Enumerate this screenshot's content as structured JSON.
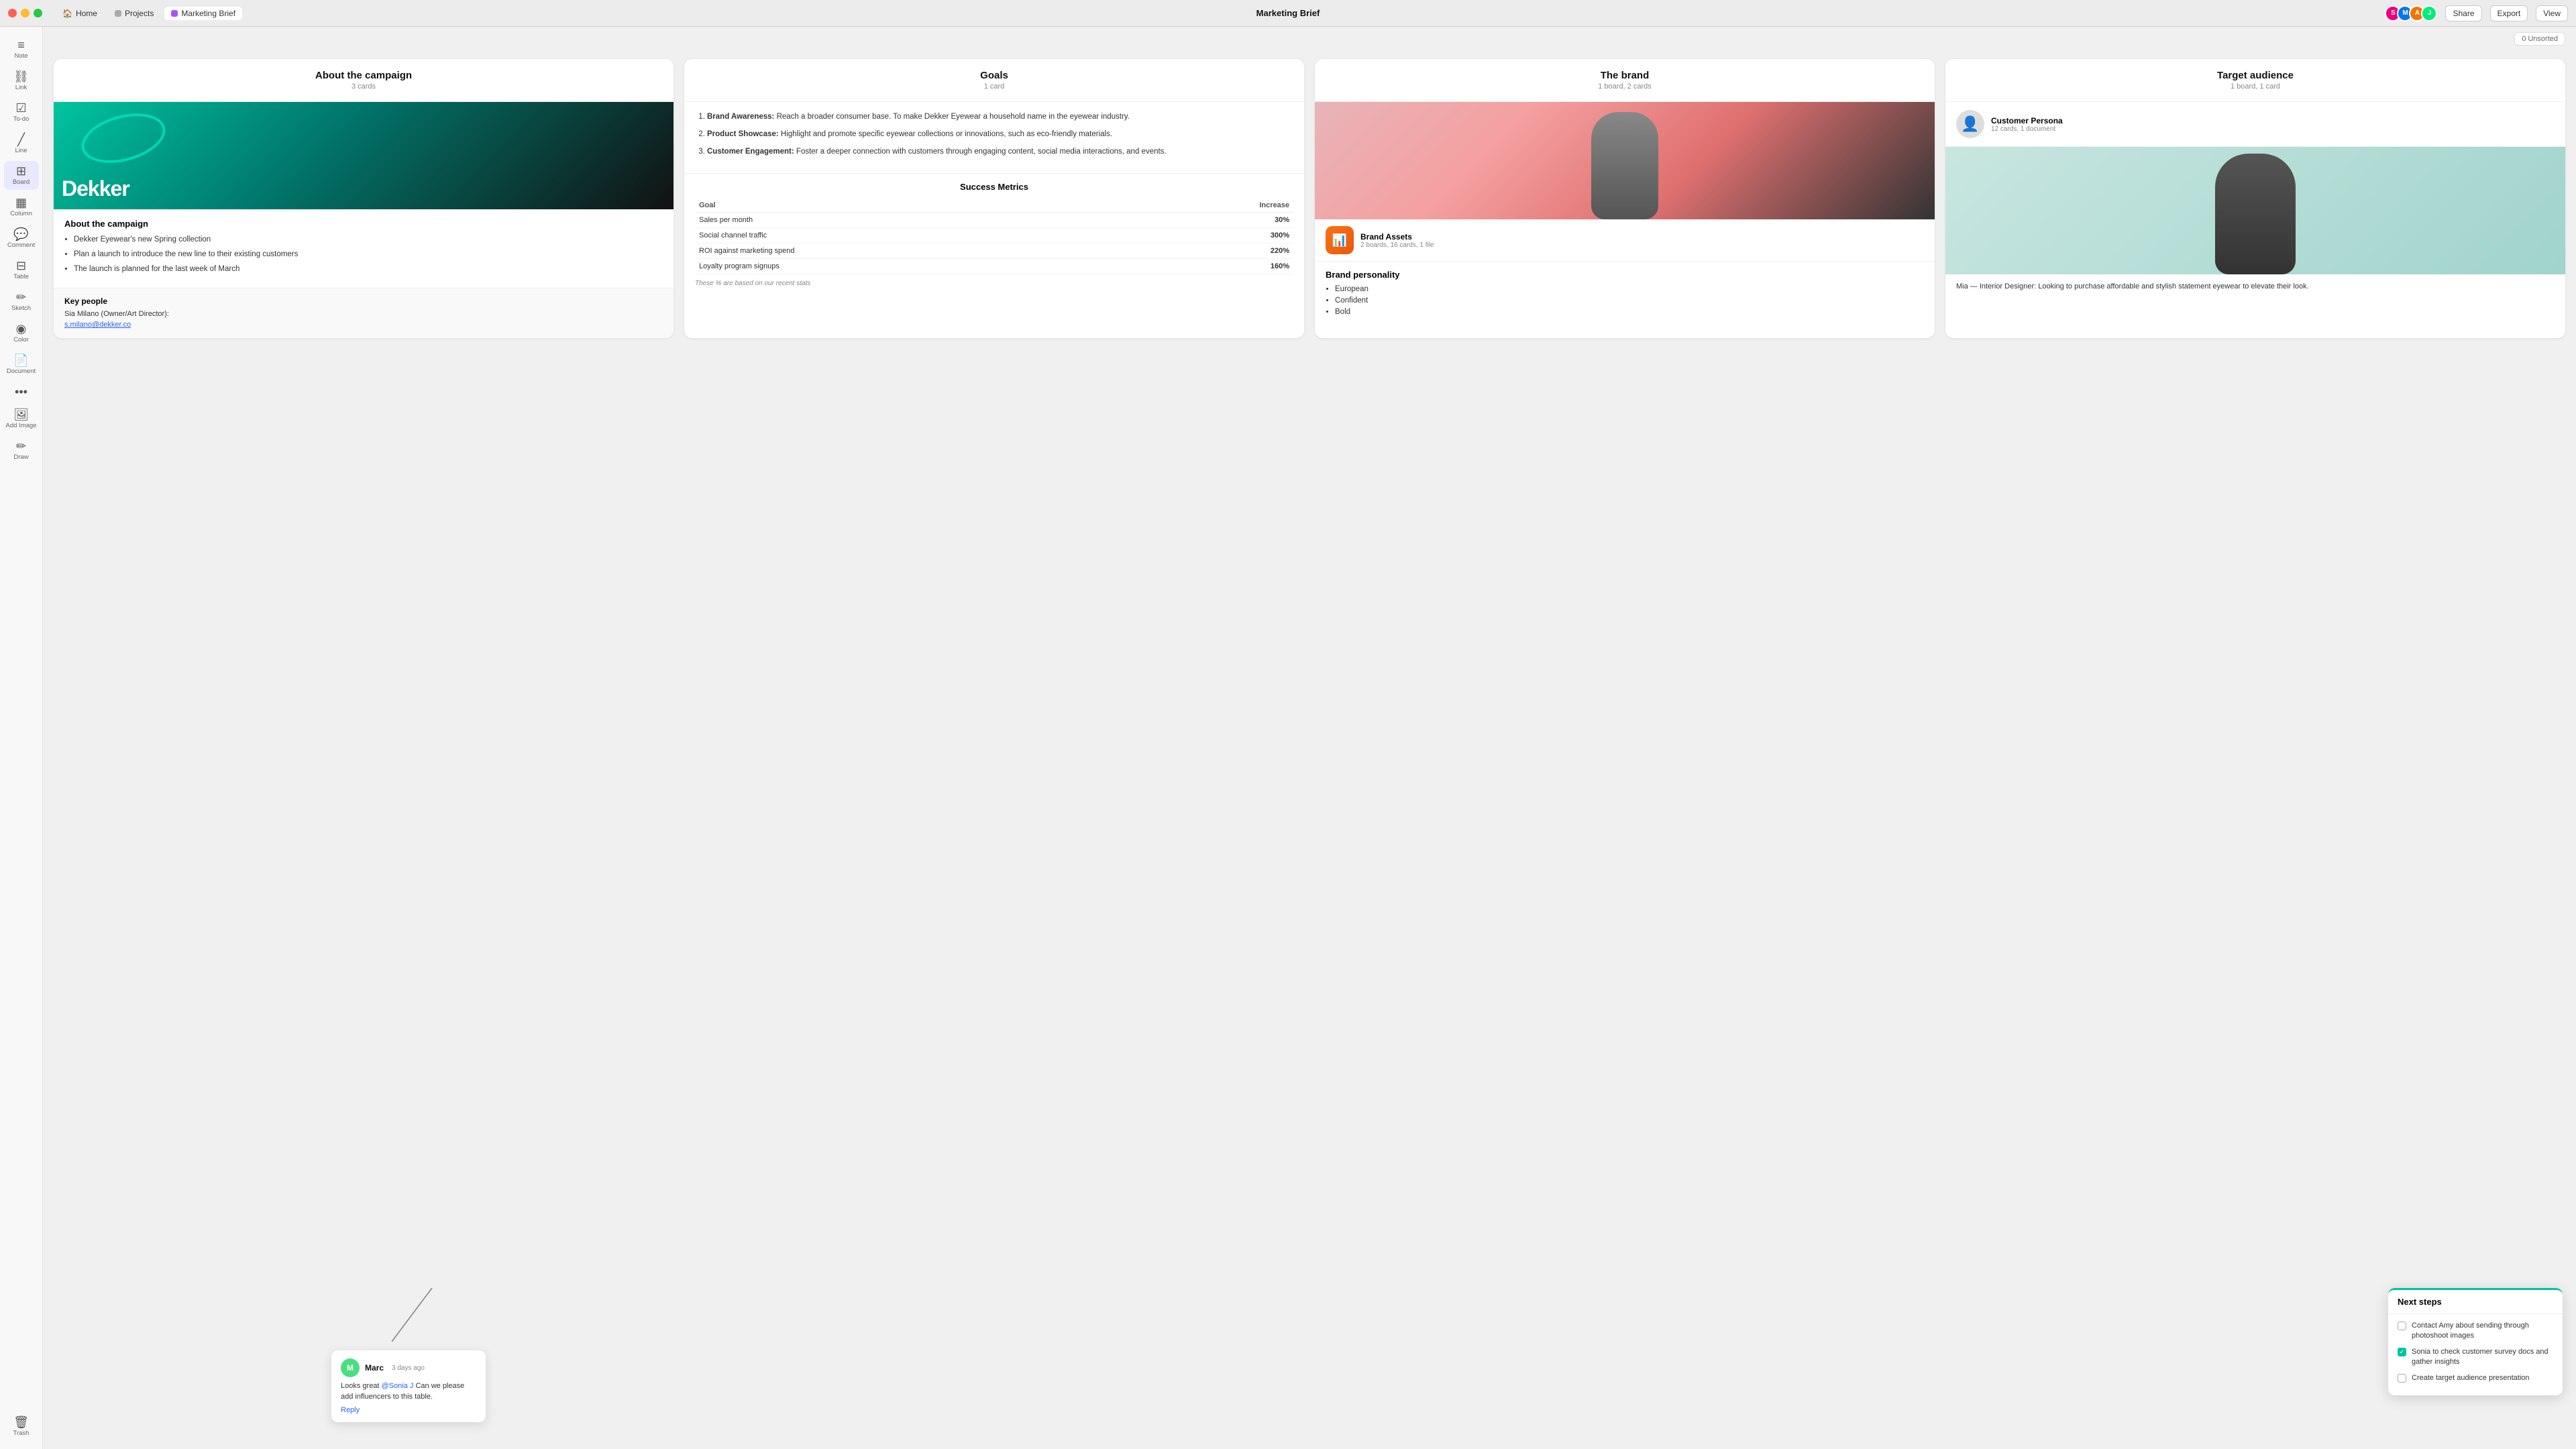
{
  "titlebar": {
    "title": "Marketing Brief",
    "tabs": [
      {
        "label": "Home",
        "dot": "none",
        "active": false
      },
      {
        "label": "Projects",
        "dot": "gray",
        "active": false
      },
      {
        "label": "Marketing Brief",
        "dot": "purple",
        "active": true
      }
    ],
    "right_buttons": {
      "share": "Share",
      "export": "Export",
      "view": "View"
    },
    "notifications_count": "0"
  },
  "sidebar": {
    "items": [
      {
        "label": "Note",
        "icon": "≡"
      },
      {
        "label": "Link",
        "icon": "🔗"
      },
      {
        "label": "To-do",
        "icon": "☑"
      },
      {
        "label": "Line",
        "icon": "✏"
      },
      {
        "label": "Board",
        "icon": "⊞"
      },
      {
        "label": "Column",
        "icon": "▦"
      },
      {
        "label": "Comment",
        "icon": "💬"
      },
      {
        "label": "Table",
        "icon": "⊟"
      },
      {
        "label": "Sketch",
        "icon": "✏"
      },
      {
        "label": "Color",
        "icon": "◉"
      },
      {
        "label": "Document",
        "icon": "📄"
      },
      {
        "label": "...",
        "icon": "•••"
      },
      {
        "label": "Add Image",
        "icon": "🖼"
      },
      {
        "label": "Draw",
        "icon": "✏"
      },
      {
        "label": "Trash",
        "icon": "🗑"
      }
    ]
  },
  "unsorted_badge": "0 Unsorted",
  "cards": {
    "about_campaign": {
      "title": "About the campaign",
      "subtitle": "3 cards",
      "brand_name": "Dekker",
      "section_title": "About the campaign",
      "bullets": [
        "Dekker Eyewear's new Spring collection",
        "Plan a launch to introduce the new line to their existing customers",
        "The launch is planned for the last week of March"
      ],
      "key_people_title": "Key people",
      "key_person": "Sia Milano (Owner/Art Director):",
      "key_email": "s.milano@dekker.co"
    },
    "goals": {
      "title": "Goals",
      "subtitle": "1 card",
      "items": [
        {
          "title": "Brand Awareness:",
          "text": "Reach a broader consumer base. To make Dekker Eyewear a household name in the eyewear industry."
        },
        {
          "title": "Product Showcase:",
          "text": "Highlight and promote specific eyewear collections or innovations, such as eco-friendly materials."
        },
        {
          "title": "Customer Engagement:",
          "text": "Foster a deeper connection with customers through engaging content, social media interactions, and events."
        }
      ],
      "metrics": {
        "title": "Success Metrics",
        "col1": "Goal",
        "col2": "Increase",
        "rows": [
          {
            "goal": "Sales per month",
            "increase": "30%"
          },
          {
            "goal": "Social channel traffic",
            "increase": "300%"
          },
          {
            "goal": "ROI against marketing spend",
            "increase": "220%"
          },
          {
            "goal": "Loyalty program signups",
            "increase": "160%"
          }
        ],
        "note": "These % are based on our recent stats"
      }
    },
    "brand": {
      "title": "The brand",
      "subtitle": "1 board, 2 cards",
      "assets": {
        "icon": "📊",
        "title": "Brand Assets",
        "subtitle": "2 boards, 16 cards, 1 file"
      },
      "personality": {
        "title": "Brand personality",
        "traits": [
          "European",
          "Confident",
          "Bold"
        ]
      }
    },
    "target_audience": {
      "title": "Target audience",
      "subtitle": "1 board, 1 card",
      "persona": {
        "title": "Customer Persona",
        "subtitle": "12 cards, 1 document"
      },
      "description": "Mia — Interior Designer: Looking to purchase affordable and stylish statement eyewear to elevate their look."
    }
  },
  "next_steps": {
    "title": "Next steps",
    "items": [
      {
        "text": "Contact Amy about sending through photoshoot images",
        "checked": false
      },
      {
        "text": "Sonia to check customer survey docs and gather insights",
        "checked": true
      },
      {
        "text": "Create target audience presentation",
        "checked": false
      }
    ]
  },
  "comment": {
    "author": "Marc",
    "time": "3 days ago",
    "avatar_letter": "M",
    "text": "Looks great ",
    "mention": "@Sonia J",
    "text2": " Can we please add influencers to this table.",
    "reply_label": "Reply"
  }
}
